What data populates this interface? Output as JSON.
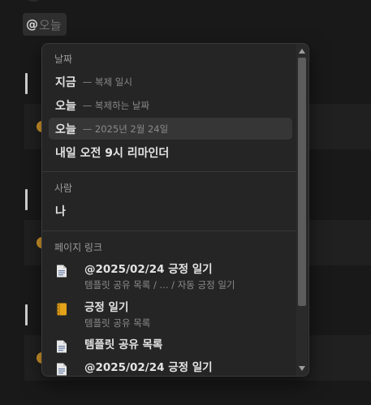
{
  "mention": {
    "at": "@",
    "query": "오늘"
  },
  "menu": {
    "sections": {
      "date": "날짜",
      "people": "사람",
      "page_links": "페이지 링크"
    },
    "date_items": [
      {
        "label": "지금",
        "desc": "— 복제 일시"
      },
      {
        "label": "오늘",
        "desc": "— 복제하는 날짜"
      },
      {
        "label": "오늘",
        "desc": "— 2025년 2월 24일"
      },
      {
        "label": "내일 오전 9시 리마인더",
        "desc": ""
      }
    ],
    "people_items": [
      {
        "label": "나"
      }
    ],
    "page_items": [
      {
        "icon": "document-icon",
        "title": "@2025/02/24 긍정 일기",
        "sub": "템플릿 공유 목록 / ... / 자동 긍정 일기"
      },
      {
        "icon": "notebook-icon",
        "title": "긍정 일기",
        "sub": "템플릿 공유 목록"
      },
      {
        "icon": "document-icon",
        "title": "템플릿 공유 목록",
        "sub": ""
      },
      {
        "icon": "document-icon",
        "title": "@2025/02/24 긍정 일기",
        "sub": ""
      }
    ],
    "selected_index": 2
  },
  "colors": {
    "accent_dot": "#d89b2a",
    "menu_bg": "#252525",
    "selected_bg": "#363636"
  }
}
